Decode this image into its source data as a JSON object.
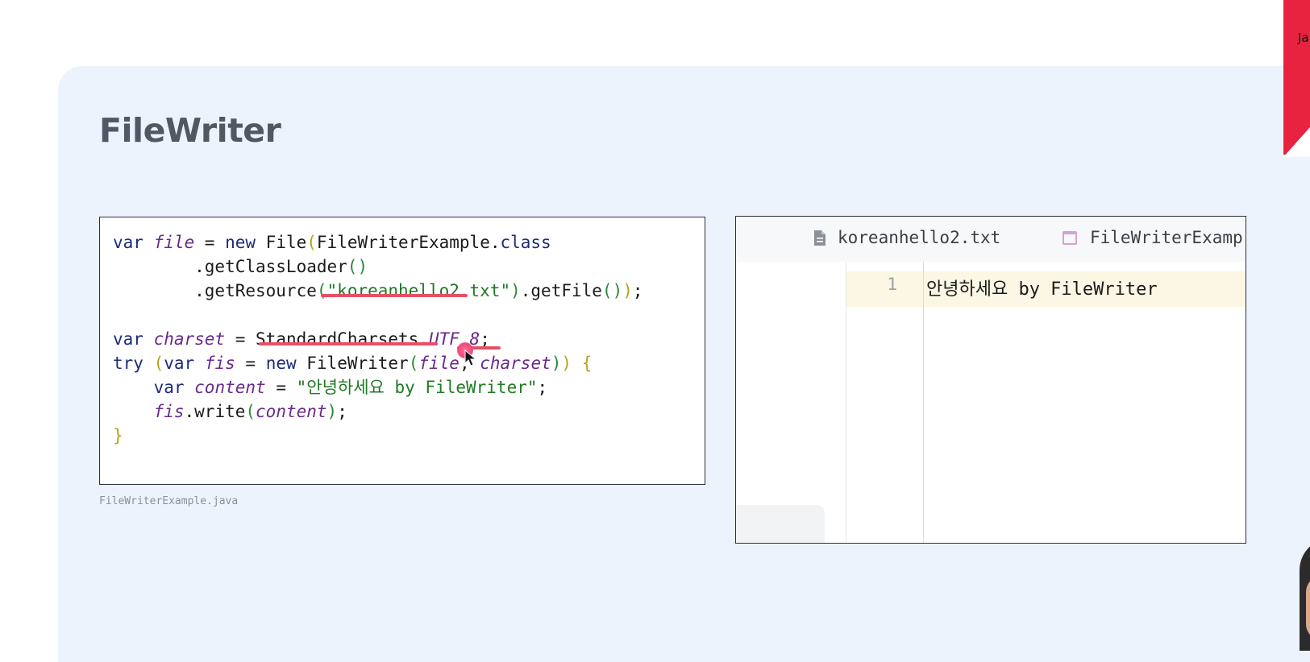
{
  "slide": {
    "title": "FileWriter",
    "caption": "FileWriterExample.java"
  },
  "code_lines": [
    [
      {
        "t": "var ",
        "c": "kw"
      },
      {
        "t": "file",
        "c": "var"
      },
      {
        "t": " = ",
        "c": ""
      },
      {
        "t": "new ",
        "c": "kw"
      },
      {
        "t": "File",
        "c": ""
      },
      {
        "t": "(",
        "c": "br1"
      },
      {
        "t": "FileWriterExample.",
        "c": ""
      },
      {
        "t": "class",
        "c": "kw"
      }
    ],
    [
      {
        "t": "        .getClassLoader",
        "c": ""
      },
      {
        "t": "()",
        "c": "br2"
      }
    ],
    [
      {
        "t": "        .getResource",
        "c": ""
      },
      {
        "t": "(",
        "c": "br2"
      },
      {
        "t": "\"koreanhello2.txt\"",
        "c": "str"
      },
      {
        "t": ")",
        "c": "br2"
      },
      {
        "t": ".getFile",
        "c": ""
      },
      {
        "t": "()",
        "c": "br2"
      },
      {
        "t": ")",
        "c": "br1"
      },
      {
        "t": ";",
        "c": ""
      }
    ],
    [],
    [
      {
        "t": "var ",
        "c": "kw"
      },
      {
        "t": "charset",
        "c": "var"
      },
      {
        "t": " = ",
        "c": ""
      },
      {
        "t": "StandardCharsets.",
        "c": ""
      },
      {
        "t": "UTF_8",
        "c": "fld"
      },
      {
        "t": ";",
        "c": ""
      }
    ],
    [
      {
        "t": "try ",
        "c": "kw"
      },
      {
        "t": "(",
        "c": "br1"
      },
      {
        "t": "var ",
        "c": "kw"
      },
      {
        "t": "fis",
        "c": "var"
      },
      {
        "t": " = ",
        "c": ""
      },
      {
        "t": "new ",
        "c": "kw"
      },
      {
        "t": "FileWriter",
        "c": ""
      },
      {
        "t": "(",
        "c": "br2"
      },
      {
        "t": "file",
        "c": "var"
      },
      {
        "t": ", ",
        "c": ""
      },
      {
        "t": "charset",
        "c": "var"
      },
      {
        "t": ")",
        "c": "br2"
      },
      {
        "t": ")",
        "c": "br1"
      },
      {
        "t": " {",
        "c": "br1"
      }
    ],
    [
      {
        "t": "    var ",
        "c": "kw"
      },
      {
        "t": "content",
        "c": "var"
      },
      {
        "t": " = ",
        "c": ""
      },
      {
        "t": "\"안녕하세요 by FileWriter\"",
        "c": "str"
      },
      {
        "t": ";",
        "c": ""
      }
    ],
    [
      {
        "t": "    ",
        "c": ""
      },
      {
        "t": "fis",
        "c": "var"
      },
      {
        "t": ".write",
        "c": ""
      },
      {
        "t": "(",
        "c": "br2"
      },
      {
        "t": "content",
        "c": "var"
      },
      {
        "t": ")",
        "c": "br2"
      },
      {
        "t": ";",
        "c": ""
      }
    ],
    [
      {
        "t": "}",
        "c": "br1"
      }
    ]
  ],
  "editor": {
    "tabs": [
      {
        "label": "koreanhello2.txt",
        "icon": "text-file-icon"
      },
      {
        "label": "FileWriterExamp",
        "icon": "java-class-icon"
      }
    ],
    "lines": [
      {
        "number": "1",
        "text": "안녕하세요 by FileWriter"
      }
    ]
  },
  "corner_label": "Ja",
  "colors": {
    "slide_bg": "#edf3fd",
    "title": "#505865",
    "underline": "#e55066",
    "brand_red": "#e8233f",
    "current_line": "#fbf7e4"
  }
}
